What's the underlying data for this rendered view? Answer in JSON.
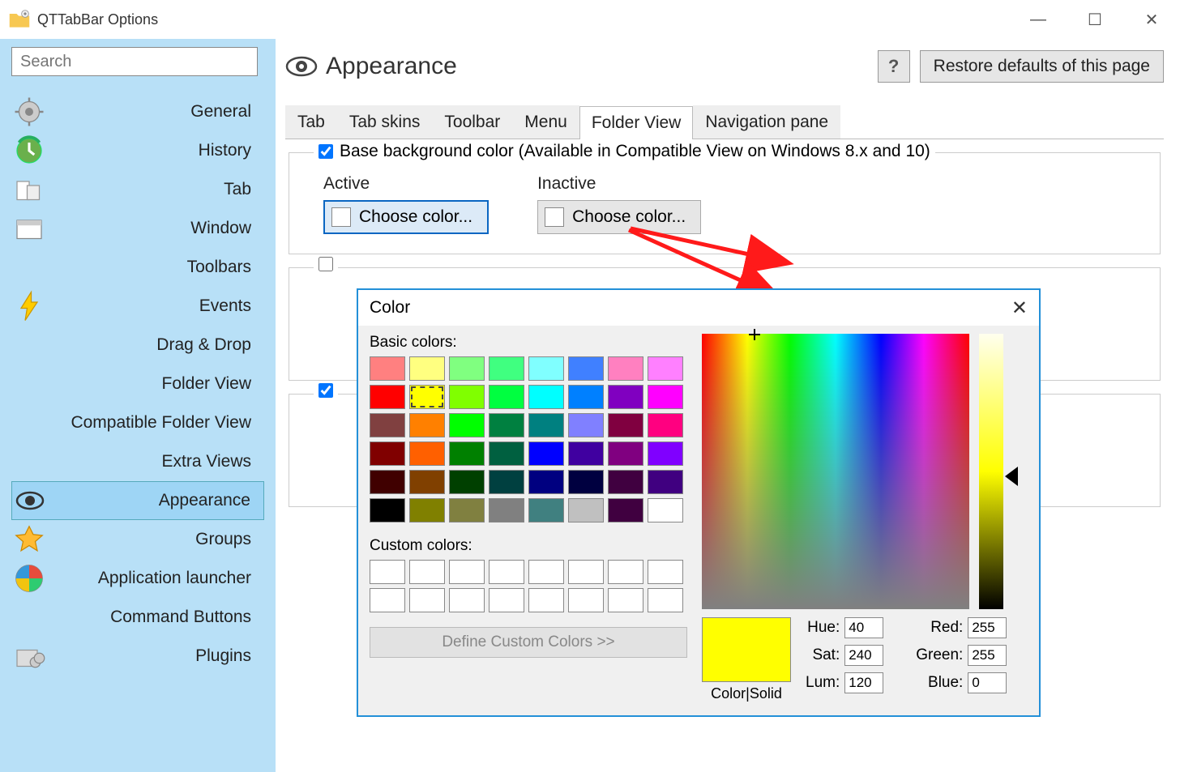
{
  "window": {
    "title": "QTTabBar Options",
    "controls": {
      "min": "—",
      "max": "☐",
      "close": "✕"
    }
  },
  "sidebar": {
    "search_placeholder": "Search",
    "items": [
      {
        "label": "General"
      },
      {
        "label": "History"
      },
      {
        "label": "Tab"
      },
      {
        "label": "Window"
      },
      {
        "label": "Toolbars"
      },
      {
        "label": "Events"
      },
      {
        "label": "Drag & Drop"
      },
      {
        "label": "Folder View"
      },
      {
        "label": "Compatible Folder View"
      },
      {
        "label": "Extra Views"
      },
      {
        "label": "Appearance"
      },
      {
        "label": "Groups"
      },
      {
        "label": "Application launcher"
      },
      {
        "label": "Command Buttons"
      },
      {
        "label": "Plugins"
      }
    ]
  },
  "page": {
    "title": "Appearance",
    "help_btn": "?",
    "restore_btn": "Restore defaults of this page"
  },
  "tabs": [
    "Tab",
    "Tab skins",
    "Toolbar",
    "Menu",
    "Folder View",
    "Navigation pane"
  ],
  "active_tab": "Folder View",
  "group1": {
    "checked": true,
    "label": "Base background color (Available in Compatible View on Windows 8.x and 10)",
    "active_label": "Active",
    "inactive_label": "Inactive",
    "choose_label": "Choose color..."
  },
  "color_dialog": {
    "title": "Color",
    "basic_label": "Basic colors:",
    "custom_label": "Custom colors:",
    "define_label": "Define Custom Colors >>",
    "color_solid": "Color|Solid",
    "basic_colors": [
      "#ff8080",
      "#ffff80",
      "#80ff80",
      "#40ff80",
      "#80ffff",
      "#4080ff",
      "#ff80c0",
      "#ff80ff",
      "#ff0000",
      "#ffff00",
      "#80ff00",
      "#00ff40",
      "#00ffff",
      "#0080ff",
      "#8000c0",
      "#ff00ff",
      "#804040",
      "#ff8000",
      "#00ff00",
      "#008040",
      "#008080",
      "#8080ff",
      "#800040",
      "#ff0080",
      "#800000",
      "#ff6000",
      "#008000",
      "#006040",
      "#0000ff",
      "#4000a0",
      "#800080",
      "#8000ff",
      "#400000",
      "#804000",
      "#004000",
      "#004040",
      "#000080",
      "#000040",
      "#400040",
      "#400080",
      "#000000",
      "#808000",
      "#808040",
      "#808080",
      "#408080",
      "#c0c0c0",
      "#400040",
      "#ffffff"
    ],
    "selected_basic": 9,
    "hue_label": "Hue:",
    "sat_label": "Sat:",
    "lum_label": "Lum:",
    "red_label": "Red:",
    "green_label": "Green:",
    "blue_label": "Blue:",
    "hue": "40",
    "sat": "240",
    "lum": "120",
    "red": "255",
    "green": "255",
    "blue": "0"
  }
}
